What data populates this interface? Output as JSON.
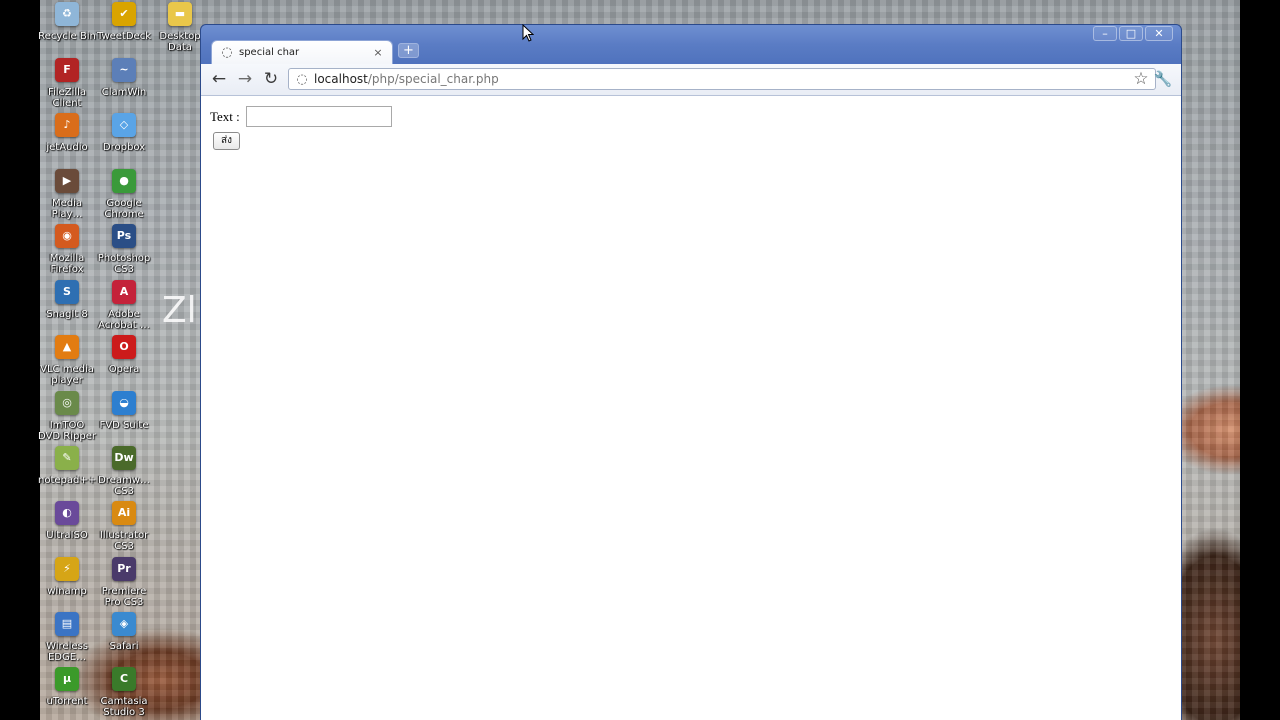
{
  "desktop": {
    "icons": [
      {
        "label": "Recycle Bin",
        "icon": "recycle-bin-icon",
        "glyph": "♻",
        "color": "#8fb6d8"
      },
      {
        "label": "TweetDeck",
        "icon": "tweetdeck-icon",
        "glyph": "✔",
        "color": "#d9a400"
      },
      {
        "label": "Desktop Data",
        "icon": "folder-icon",
        "glyph": "▬",
        "color": "#e9c74a"
      },
      {
        "label": "FileZilla Client",
        "icon": "filezilla-icon",
        "glyph": "F",
        "color": "#b22424"
      },
      {
        "label": "ClamWin",
        "icon": "clamwin-icon",
        "glyph": "~",
        "color": "#5c7fb8"
      },
      {
        "label": "jetAudio",
        "icon": "jetaudio-icon",
        "glyph": "♪",
        "color": "#d96d1b"
      },
      {
        "label": "Dropbox",
        "icon": "dropbox-icon",
        "glyph": "◇",
        "color": "#5aa4e6"
      },
      {
        "label": "Media Play…",
        "icon": "media-player-icon",
        "glyph": "▶",
        "color": "#6a4b3a"
      },
      {
        "label": "Google Chrome",
        "icon": "chrome-icon",
        "glyph": "●",
        "color": "#3a9a3a"
      },
      {
        "label": "Mozilla Firefox",
        "icon": "firefox-icon",
        "glyph": "◉",
        "color": "#d45a1f"
      },
      {
        "label": "Photoshop CS3",
        "icon": "photoshop-icon",
        "glyph": "Ps",
        "color": "#2a4e86"
      },
      {
        "label": "SnagIt 8",
        "icon": "snagit-icon",
        "glyph": "S",
        "color": "#2e6fb2"
      },
      {
        "label": "Adobe Acrobat …",
        "icon": "acrobat-icon",
        "glyph": "A",
        "color": "#c4223a"
      },
      {
        "label": "VLC media player",
        "icon": "vlc-icon",
        "glyph": "▲",
        "color": "#e27c12"
      },
      {
        "label": "Opera",
        "icon": "opera-icon",
        "glyph": "O",
        "color": "#cc1b1b"
      },
      {
        "label": "ImTOO DVD Ripper",
        "icon": "imtoo-icon",
        "glyph": "◎",
        "color": "#6a8a4a"
      },
      {
        "label": "FVD Suite",
        "icon": "fvd-icon",
        "glyph": "◒",
        "color": "#2d7fd0"
      },
      {
        "label": "notepad++",
        "icon": "notepad-icon",
        "glyph": "✎",
        "color": "#8ab04a"
      },
      {
        "label": "Dreamw… CS3",
        "icon": "dreamweaver-icon",
        "glyph": "Dw",
        "color": "#4a6a2a"
      },
      {
        "label": "UltraISO",
        "icon": "ultraiso-icon",
        "glyph": "◐",
        "color": "#6a4a9a"
      },
      {
        "label": "Illustrator CS3",
        "icon": "illustrator-icon",
        "glyph": "Ai",
        "color": "#d98a12"
      },
      {
        "label": "winamp",
        "icon": "winamp-icon",
        "glyph": "⚡",
        "color": "#d6a516"
      },
      {
        "label": "Premiere Pro CS3",
        "icon": "premiere-icon",
        "glyph": "Pr",
        "color": "#4a3a6a"
      },
      {
        "label": "Wireless EDGE…",
        "icon": "wireless-icon",
        "glyph": "▤",
        "color": "#3b74c4"
      },
      {
        "label": "Safari",
        "icon": "safari-icon",
        "glyph": "◈",
        "color": "#3a8ad0"
      },
      {
        "label": "uTorrent",
        "icon": "utorrent-icon",
        "glyph": "μ",
        "color": "#3b9a2a"
      },
      {
        "label": "Camtasia Studio 3",
        "icon": "camtasia-icon",
        "glyph": "C",
        "color": "#3a7a2a"
      }
    ],
    "overlay_text": "Zl"
  },
  "window": {
    "tab_title": "special char",
    "tab_close": "×",
    "new_tab": "+",
    "controls": {
      "minimize": "–",
      "maximize": "□",
      "close": "✕"
    }
  },
  "toolbar": {
    "back": "←",
    "forward": "→",
    "reload": "↻",
    "url_host": "localhost",
    "url_path": "/php/special_char.php",
    "star": "☆",
    "wrench": "🔧"
  },
  "page": {
    "text_label": "Text :",
    "text_value": "",
    "submit_label": "ส่ง"
  }
}
